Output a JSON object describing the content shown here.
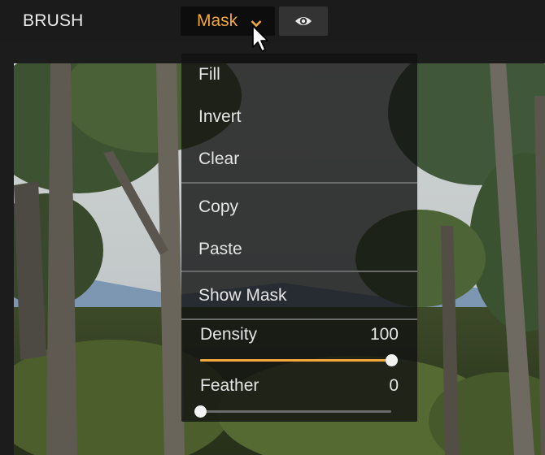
{
  "toolbar": {
    "title": "BRUSH",
    "mask_label": "Mask",
    "mask_icon": "chevron-down-icon",
    "visibility_icon": "eye-icon",
    "accent_color": "#f0a93a"
  },
  "mask_menu": {
    "items": [
      {
        "label": "Fill"
      },
      {
        "label": "Invert"
      },
      {
        "label": "Clear"
      },
      {
        "label": "Copy"
      },
      {
        "label": "Paste"
      },
      {
        "label": "Show Mask"
      }
    ],
    "density": {
      "label": "Density",
      "value": "100",
      "level": 1.0
    },
    "feather": {
      "label": "Feather",
      "value": "0",
      "level": 0.0
    }
  }
}
